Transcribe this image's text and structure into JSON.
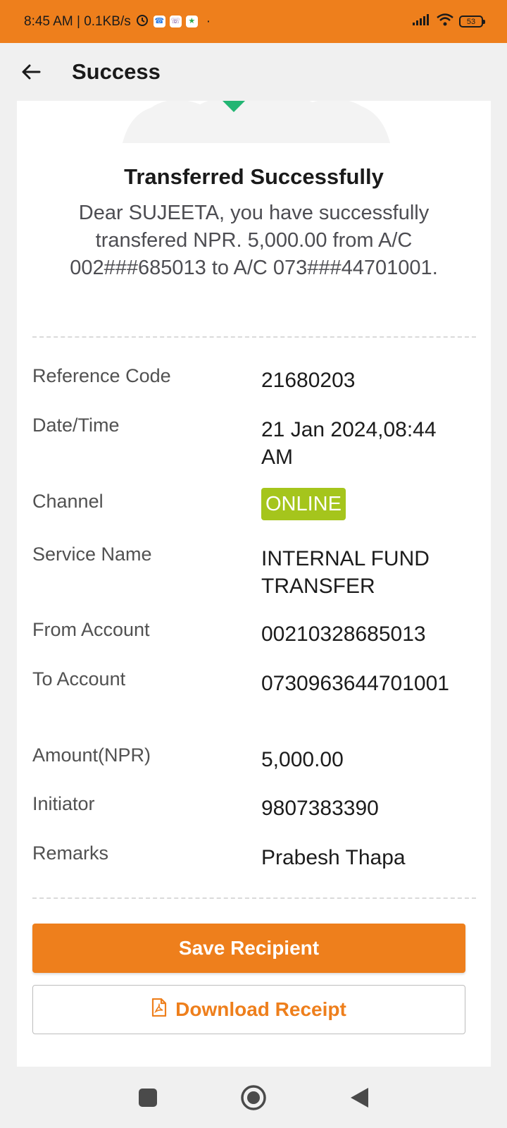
{
  "status_bar": {
    "time_speed": "8:45 AM | 0.1KB/s",
    "battery": "53",
    "icons": [
      "alarm-icon",
      "phone-app-icon",
      "viber-app-icon",
      "app-icon",
      "signal-icon",
      "wifi-icon",
      "battery-icon"
    ]
  },
  "header": {
    "title": "Success",
    "back_icon": "back-arrow-icon"
  },
  "card": {
    "title": "Transferred Successfully",
    "message": "Dear SUJEETA, you have successfully transfered NPR. 5,000.00 from A/C 002###685013 to A/C 073###44701001."
  },
  "details": [
    {
      "label": "Reference Code",
      "value": "21680203"
    },
    {
      "label": "Date/Time",
      "value": "21 Jan 2024,08:44 AM"
    },
    {
      "label": "Channel",
      "value": "ONLINE"
    },
    {
      "label": "Service Name",
      "value": "INTERNAL FUND TRANSFER"
    },
    {
      "label": "From Account",
      "value": "00210328685013"
    },
    {
      "label": "To Account",
      "value": "0730963644701001"
    },
    {
      "label": "Amount(NPR)",
      "value": "5,000.00"
    },
    {
      "label": "Initiator",
      "value": "9807383390"
    },
    {
      "label": "Remarks",
      "value": "Prabesh Thapa"
    }
  ],
  "colors": {
    "accent": "#ee7f1c",
    "badge": "#a5c51c",
    "success": "#22b573"
  },
  "actions": {
    "save_label": "Save Recipient",
    "download_label": "Download Receipt",
    "download_icon": "pdf-file-icon"
  },
  "nav": {
    "icons": [
      "recents-square-icon",
      "home-circle-icon",
      "back-triangle-icon"
    ]
  }
}
